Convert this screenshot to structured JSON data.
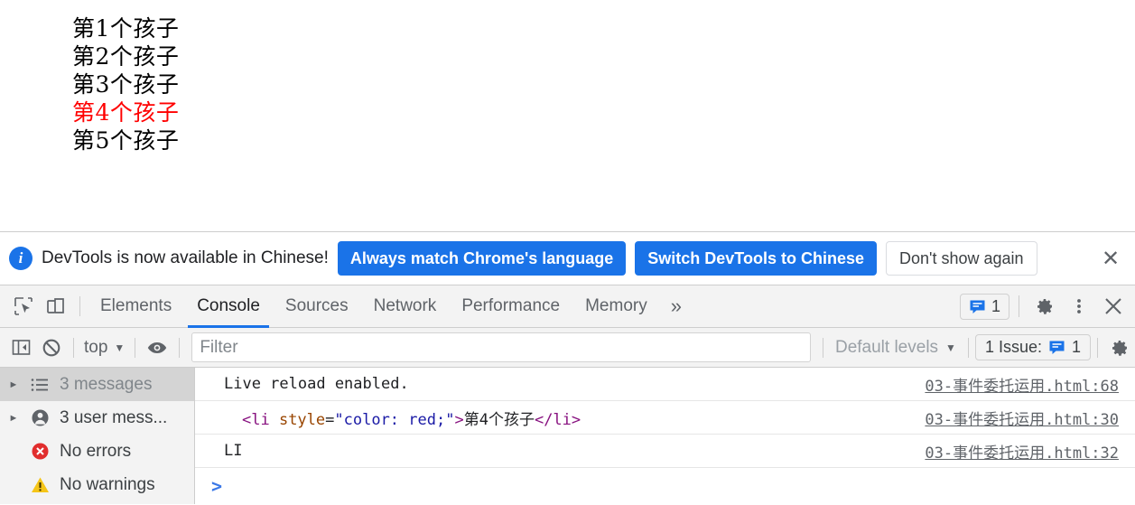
{
  "page": {
    "list_items": [
      {
        "text": "第1个孩子",
        "color": "#000000"
      },
      {
        "text": "第2个孩子",
        "color": "#000000"
      },
      {
        "text": "第3个孩子",
        "color": "#000000"
      },
      {
        "text": "第4个孩子",
        "color": "#ff0000"
      },
      {
        "text": "第5个孩子",
        "color": "#000000"
      }
    ]
  },
  "banner": {
    "icon": "info-icon",
    "message": "DevTools is now available in Chinese!",
    "primary_button": "Always match Chrome's language",
    "secondary_button": "Switch DevTools to Chinese",
    "dismiss_button": "Don't show again",
    "close_icon": "close-icon",
    "accent_color": "#1a73e8"
  },
  "tabbar": {
    "inspect_icon": "inspect-element-icon",
    "device_icon": "device-toolbar-icon",
    "tabs": [
      {
        "label": "Elements",
        "active": false
      },
      {
        "label": "Console",
        "active": true
      },
      {
        "label": "Sources",
        "active": false
      },
      {
        "label": "Network",
        "active": false
      },
      {
        "label": "Performance",
        "active": false
      },
      {
        "label": "Memory",
        "active": false
      }
    ],
    "more_tabs_icon": "chevron-double-right-icon",
    "issues_count": "1",
    "settings_icon": "gear-icon",
    "menu_icon": "kebab-menu-icon",
    "close_icon": "close-icon",
    "active_tab_color": "#1a73e8"
  },
  "console_toolbar": {
    "sidebar_toggle_icon": "show-console-sidebar-icon",
    "clear_icon": "clear-console-icon",
    "context": "top",
    "context_caret": "chevron-down-icon",
    "eye_icon": "live-expression-icon",
    "filter_placeholder": "Filter",
    "filter_value": "",
    "levels": "Default levels",
    "levels_caret": "chevron-down-icon",
    "issue_label": "1 Issue:",
    "issue_count": "1",
    "settings_icon": "gear-icon"
  },
  "console_sidebar": {
    "items": [
      {
        "label": "3 messages",
        "icon": "list-icon",
        "expandable": true,
        "selected": true,
        "muted": true
      },
      {
        "label": "3 user mess...",
        "icon": "user-icon",
        "expandable": true,
        "selected": false,
        "muted": false
      },
      {
        "label": "No errors",
        "icon": "error-icon",
        "expandable": false,
        "selected": false,
        "muted": false
      },
      {
        "label": "No warnings",
        "icon": "warning-icon",
        "expandable": false,
        "selected": false,
        "muted": false
      }
    ]
  },
  "console_messages": [
    {
      "kind": "plain",
      "text": "Live reload enabled.",
      "source": "03-事件委托运用.html:68",
      "indented": false
    },
    {
      "kind": "html",
      "tokens": [
        {
          "t": "<li ",
          "c": "tag"
        },
        {
          "t": "style",
          "c": "attr"
        },
        {
          "t": "=",
          "c": "plain"
        },
        {
          "t": "\"color: red;\"",
          "c": "val"
        },
        {
          "t": ">",
          "c": "tag"
        },
        {
          "t": "第4个孩子",
          "c": "plain"
        },
        {
          "t": "</li>",
          "c": "tag"
        }
      ],
      "source": "03-事件委托运用.html:30",
      "indented": true
    },
    {
      "kind": "plain",
      "text": "LI",
      "source": "03-事件委托运用.html:32",
      "indented": false
    }
  ],
  "prompt": {
    "caret": ">",
    "value": ""
  }
}
